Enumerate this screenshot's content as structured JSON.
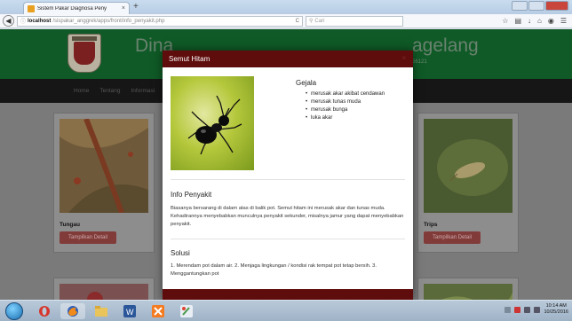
{
  "browser": {
    "tab_title": "Sistem Pakar Diagnosa Peny",
    "tab_close": "×",
    "new_tab": "+",
    "url_host": "localhost",
    "url_path": "/sispakar_anggrek/apps/front/info_penyakit.php",
    "search_placeholder": "Cari",
    "reload_glyph": "C"
  },
  "site": {
    "title_left": "Dina",
    "title_right": "agelang",
    "subtitle": "56121",
    "menu": [
      "Home",
      "Tentang",
      "Informasi"
    ]
  },
  "cards": [
    {
      "name": "Tungau",
      "button": "Tampilkan Detail"
    },
    {
      "name": "Trips",
      "button": "Tampilkan Detail"
    }
  ],
  "modal": {
    "title": "Semut Hitam",
    "close": "×",
    "gejala_title": "Gejala",
    "gejala": [
      "merusak akar akibat cendawan",
      "merusak tunas muda",
      "merusak bunga",
      "luka akar"
    ],
    "info_title": "Info Penyakit",
    "info_text": "Biasanya bersarang di dalam atas di balik pot. Semut hitam ini merusak akar dan tunas muda. Kehadirannya menyebabkan munculnya penyakit sekunder, misalnya jamur yang dapat menyebabkan penyakit.",
    "solusi_title": "Solusi",
    "solusi_text": "1. Merendam pot dalam air. 2. Menjaga lingkungan / kondisi rak tempat pot tetap bersih. 3. Menggantungkan pot"
  },
  "taskbar": {
    "time": "10:14 AM",
    "date": "10/25/2016"
  },
  "colors": {
    "header_green": "#0f5a26",
    "modal_maroon": "#5f0c0c",
    "button_red": "#813c3a"
  }
}
